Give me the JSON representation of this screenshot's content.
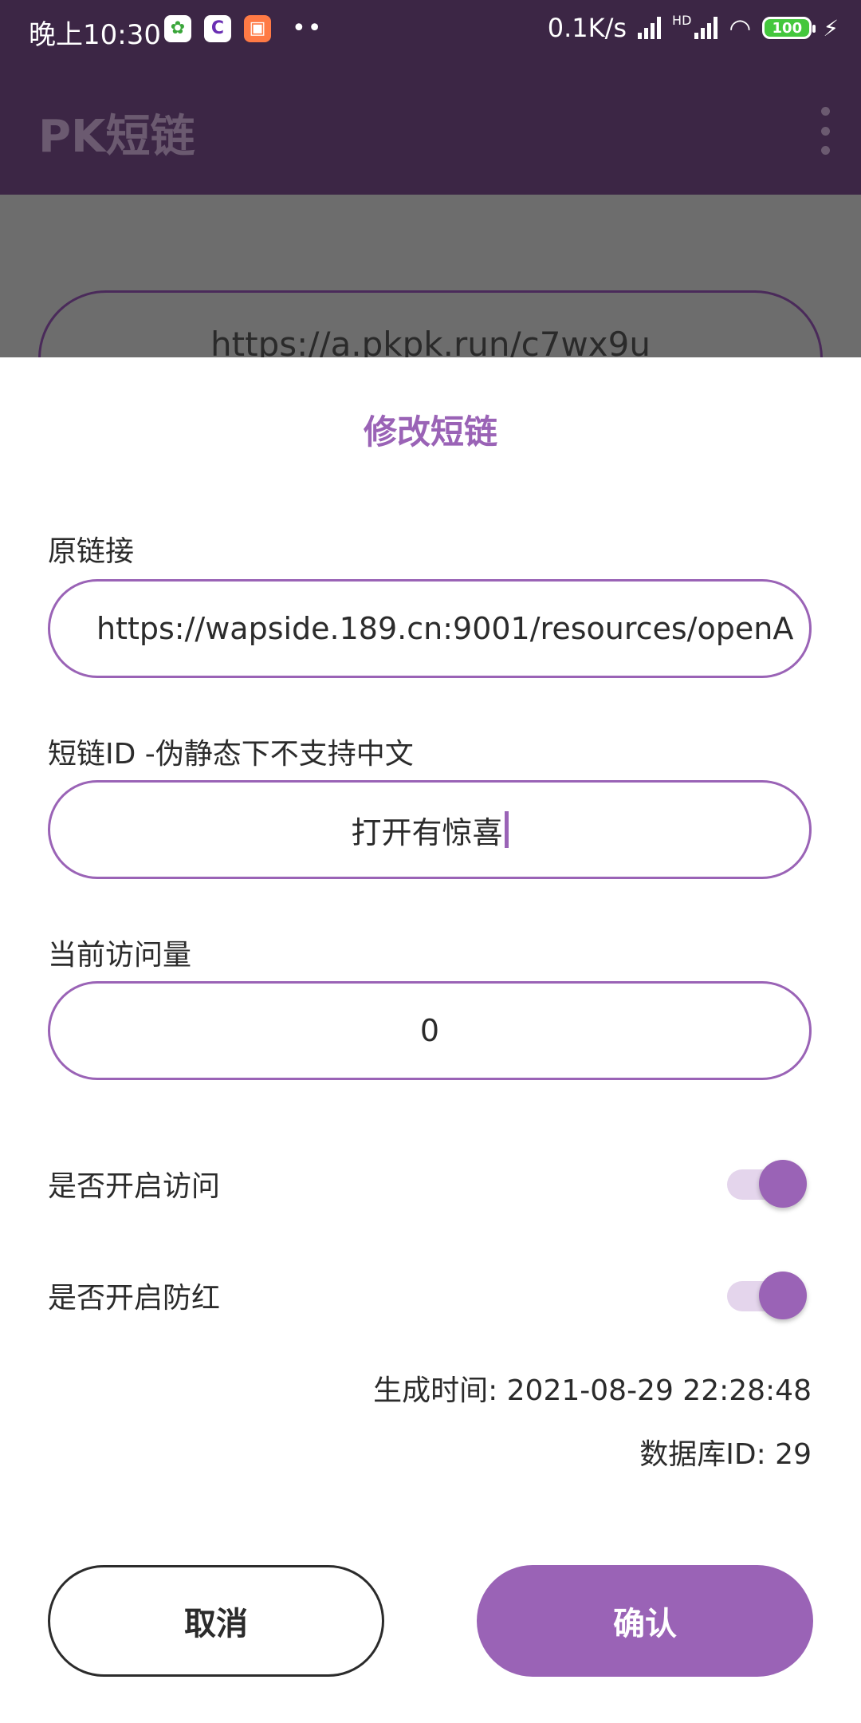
{
  "status_bar": {
    "time": "晚上10:30",
    "notif_dots": "••",
    "net_speed": "0.1K/s",
    "hd_label": "HD",
    "battery": "100"
  },
  "app_bar": {
    "title": "PK短链"
  },
  "background": {
    "short_url": "https://a.pkpk.run/c7wx9u"
  },
  "dialog": {
    "title": "修改短链",
    "original_link_label": "原链接",
    "original_link_value": "https://wapside.189.cn:9001/resources/openA",
    "short_id_label": "短链ID -伪静态下不支持中文",
    "short_id_value": "打开有惊喜",
    "visits_label": "当前访问量",
    "visits_value": "0",
    "enable_access_label": "是否开启访问",
    "enable_access_on": true,
    "enable_anti_red_label": "是否开启防红",
    "enable_anti_red_on": true,
    "created_time": "生成时间: 2021-08-29 22:28:48",
    "db_id": "数据库ID: 29",
    "cancel_label": "取消",
    "confirm_label": "确认"
  },
  "colors": {
    "accent": "#9a63b6",
    "appbar": "#3c2645",
    "scrim": "#6d6d6d"
  }
}
